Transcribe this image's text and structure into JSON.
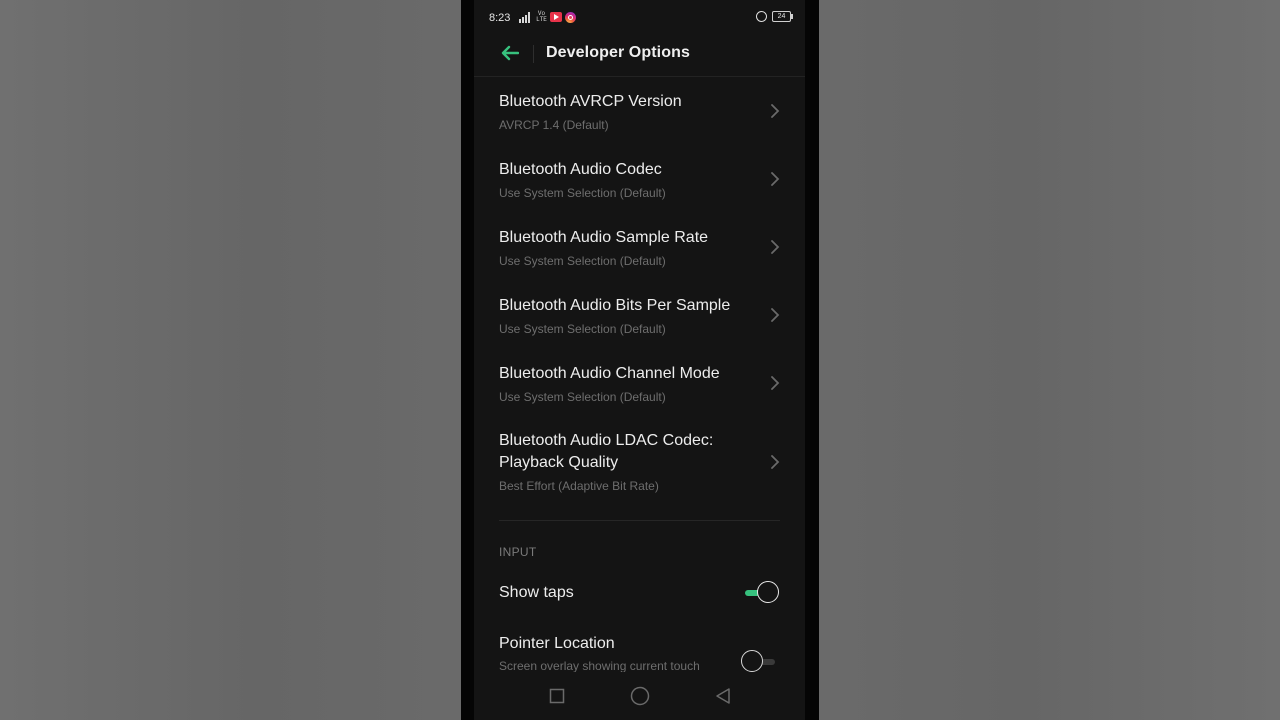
{
  "status_bar": {
    "time": "8:23",
    "volte_label": "Vo LTE",
    "battery_level": "24"
  },
  "header": {
    "title": "Developer Options"
  },
  "settings": [
    {
      "title": "Bluetooth AVRCP Version",
      "summary": "AVRCP 1.4 (Default)"
    },
    {
      "title": "Bluetooth Audio Codec",
      "summary": "Use System Selection (Default)"
    },
    {
      "title": "Bluetooth Audio Sample Rate",
      "summary": "Use System Selection (Default)"
    },
    {
      "title": "Bluetooth Audio Bits Per Sample",
      "summary": "Use System Selection (Default)"
    },
    {
      "title": "Bluetooth Audio Channel Mode",
      "summary": "Use System Selection (Default)"
    },
    {
      "title_line1": "Bluetooth Audio LDAC Codec:",
      "title_line2": "Playback Quality",
      "summary": "Best Effort (Adaptive Bit Rate)"
    }
  ],
  "input_section": {
    "header": "INPUT",
    "show_taps": {
      "title": "Show taps",
      "enabled": true
    },
    "pointer_location": {
      "title": "Pointer Location",
      "summary": "Screen overlay showing current touch",
      "enabled": false
    }
  },
  "colors": {
    "accent": "#37c17e",
    "background": "#141414"
  },
  "icons": [
    "back-arrow-icon",
    "chevron-right-icon",
    "recents-square-icon",
    "home-circle-icon",
    "back-triangle-icon"
  ]
}
